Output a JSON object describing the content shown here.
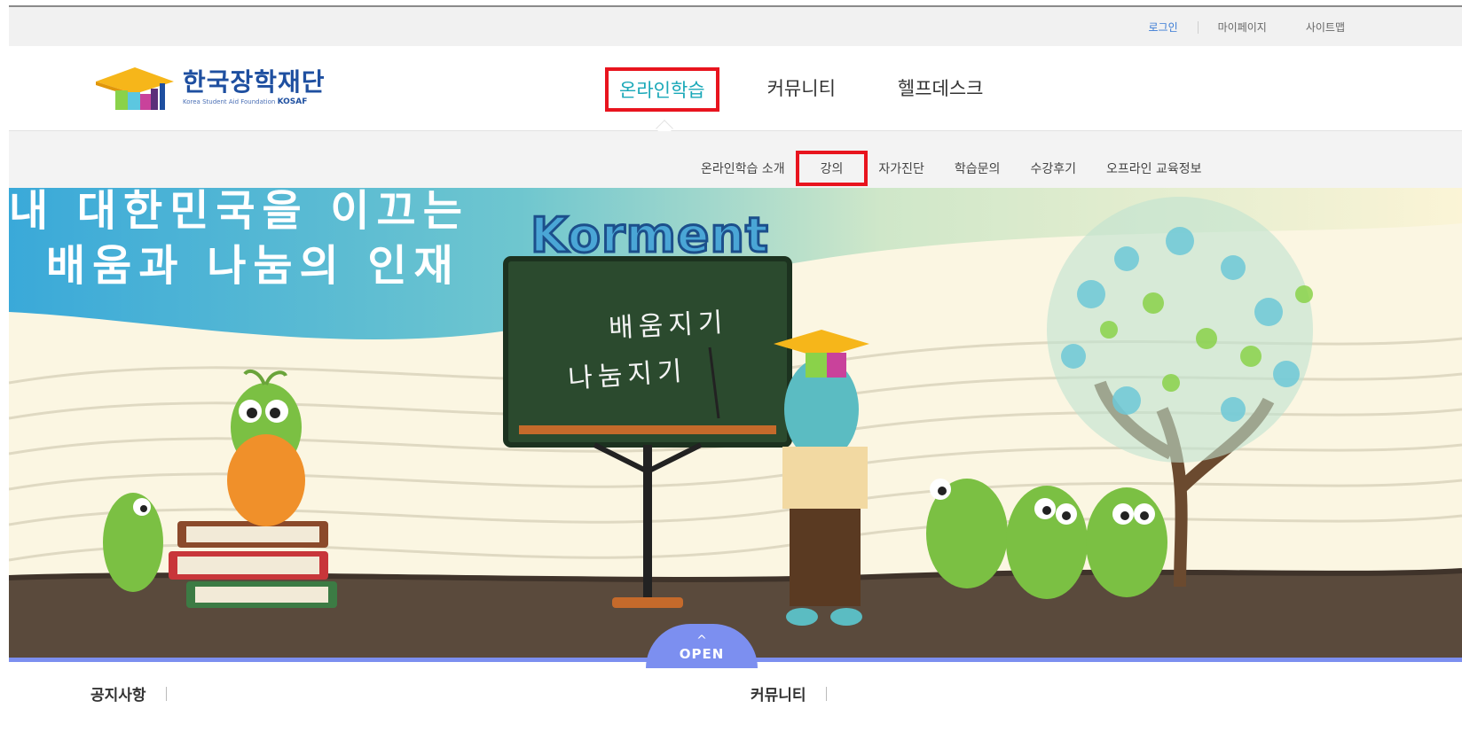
{
  "utility": {
    "login": "로그인",
    "mypage": "마이페이지",
    "sitemap": "사이트맵"
  },
  "logo": {
    "title": "한국장학재단",
    "subtitle": "Korea Student Aid Foundation",
    "acronym": "KOSAF"
  },
  "gnb": {
    "items": [
      "온라인학습",
      "커뮤니티",
      "헬프데스크"
    ],
    "active": "온라인학습"
  },
  "subnav": {
    "items": [
      "온라인학습 소개",
      "강의",
      "자가진단",
      "학습문의",
      "수강후기",
      "오프라인 교육정보"
    ],
    "active": "강의"
  },
  "banner": {
    "line1": "내 대한민국을 이끄는",
    "line2": "배움과 나눔의 인재",
    "brand": "Korment",
    "board_line1": "배움지기",
    "board_line2": "나눔지기",
    "open_label": "OPEN"
  },
  "sections": {
    "notice": "공지사항",
    "community": "커뮤니티"
  },
  "colors": {
    "accent": "#19a8b8",
    "highlight": "#e8141e",
    "open_tab": "#7c8ff0"
  }
}
